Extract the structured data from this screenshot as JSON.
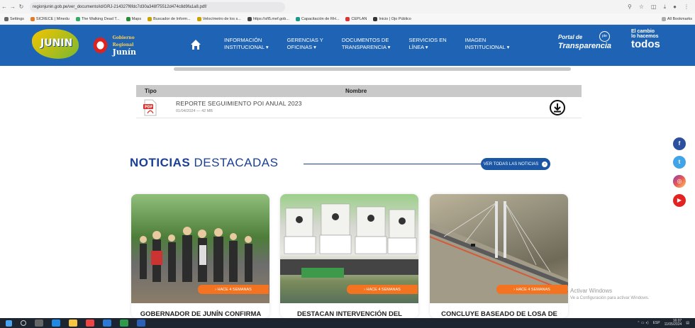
{
  "browser": {
    "url": "regionjunin.gob.pe/ver_documento/id/GRJ-214327f6fdc7d30a348f75512d474c8d9fa1a8.pdf/",
    "bookmarks": [
      "Settings",
      "SICRECE | Minedu",
      "The Walking Dead T...",
      "Maps",
      "Buscador de Inform...",
      "Velocímetro de los s...",
      "https://sfi5.mef.gob...",
      "Capacitación de RH...",
      "CEPLAN",
      "Inicio | Ojo Público"
    ],
    "all_bookmarks": "All Bookmarks"
  },
  "header": {
    "logo_text": "JUNIN",
    "gob_name_top": "Gobierno Regional",
    "gob_name": "Junín",
    "menu": [
      {
        "line1": "INFORMACIÓN",
        "line2": "INSTITUCIONAL ▾"
      },
      {
        "line1": "GERENCIAS Y",
        "line2": "OFICINAS ▾"
      },
      {
        "line1": "DOCUMENTOS DE",
        "line2": "TRANSPARENCIA ▾"
      },
      {
        "line1": "SERVICIOS EN",
        "line2": "LÍNEA ▾"
      },
      {
        "line1": "IMAGEN",
        "line2": "INSTITUCIONAL ▾"
      }
    ],
    "portal_line1": "Portal de",
    "portal_line2": "Transparencia",
    "portal_badge": "pte",
    "slogan_line1": "El cambio",
    "slogan_line2": "lo hacemos",
    "slogan_line3": "todos"
  },
  "documents": {
    "col_type": "Tipo",
    "col_name": "Nombre",
    "rows": [
      {
        "title": "REPORTE SEGUIMIENTO POI ANUAL 2023",
        "meta": "01/04/2024 — 42 MB"
      }
    ]
  },
  "news": {
    "title_bold": "NOTICIAS",
    "title_light": "DESTACADAS",
    "view_all": "VER TODAS LAS NOTICIAS",
    "cards": [
      {
        "badge": "› HACE 4 SEMANAS",
        "title": "GOBERNADOR DE JUNÍN CONFIRMA"
      },
      {
        "badge": "› HACE 4 SEMANAS",
        "title": "DESTACAN INTERVENCIÓN DEL"
      },
      {
        "badge": "› HACE 4 SEMANAS",
        "title": "CONCLUYE BASEADO DE LOSA DE"
      }
    ]
  },
  "social": {
    "facebook": "f",
    "twitter": "t",
    "instagram": "◎",
    "youtube": "▶"
  },
  "windows": {
    "activate_title": "Activar Windows",
    "activate_sub": "Ve a Configuración para activar Windows.",
    "lang": "ESP",
    "time": "16:07",
    "date": "11/05/2024"
  },
  "colors": {
    "header_blue": "#1f63b4",
    "news_blue": "#1b3f93",
    "badge_orange": "#f47320"
  }
}
